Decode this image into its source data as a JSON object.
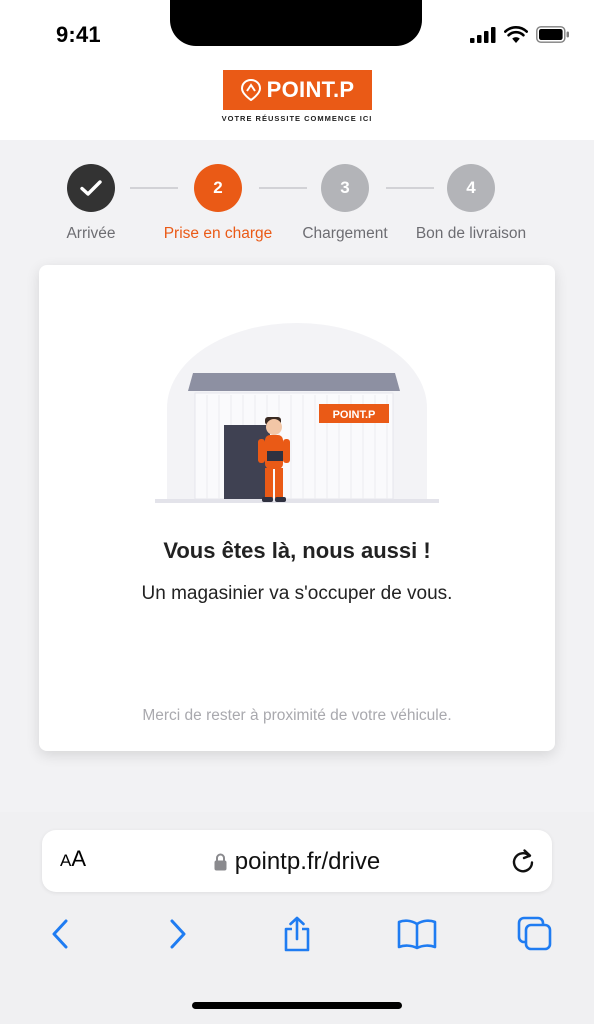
{
  "status": {
    "time": "9:41"
  },
  "brand": {
    "name": "POINT.P",
    "tagline": "VOTRE RÉUSSITE COMMENCE ICI",
    "color": "#ea5a16"
  },
  "steps": [
    {
      "number": "1",
      "label": "Arrivée",
      "state": "done"
    },
    {
      "number": "2",
      "label": "Prise en charge",
      "state": "active"
    },
    {
      "number": "3",
      "label": "Chargement",
      "state": "pending"
    },
    {
      "number": "4",
      "label": "Bon de livraison",
      "state": "pending"
    }
  ],
  "colors": {
    "done": "#333333",
    "active": "#ea5a16",
    "pending": "#b3b4b8",
    "active_label": "#ea5a16"
  },
  "card": {
    "illustration_sign": "POINT.P",
    "title": "Vous êtes là, nous aussi !",
    "subtitle": "Un magasinier va s'occuper de vous.",
    "note": "Merci de rester à proximité de votre véhicule."
  },
  "browser": {
    "aa_label_small": "A",
    "aa_label_large": "A",
    "url": "pointp.fr/drive",
    "icons": [
      "lock-icon",
      "reload-icon",
      "back-icon",
      "forward-icon",
      "share-icon",
      "bookmarks-icon",
      "tabs-icon"
    ]
  }
}
